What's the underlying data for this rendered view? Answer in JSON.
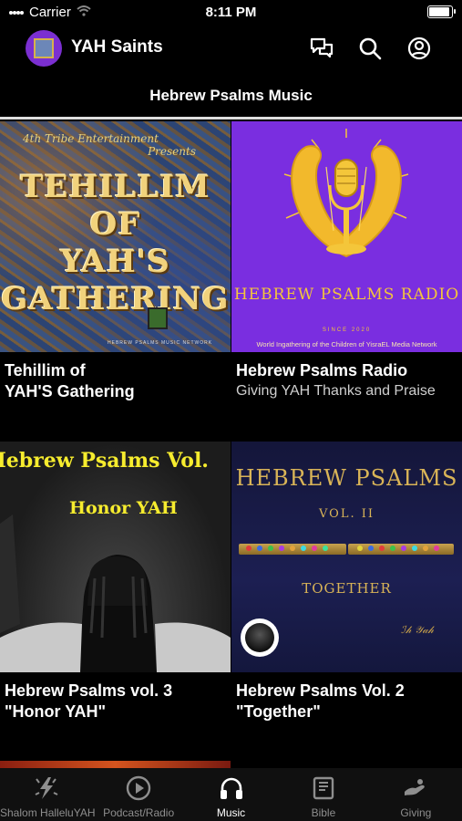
{
  "status_bar": {
    "carrier": "Carrier",
    "time": "8:11 PM"
  },
  "app_bar": {
    "title": "YAH Saints",
    "icons": [
      "chat-icon",
      "search-icon",
      "account-icon"
    ]
  },
  "screen": {
    "title": "Hebrew Psalms Music"
  },
  "albums": [
    {
      "title": "Tehillim of\nYAH'S Gathering",
      "subtitle": "",
      "art": {
        "presents_line1": "4th Tribe Entertainment",
        "presents_line2": "Presents",
        "headline": "TEHILLIM\nOF\nYAH'S\nGATHERING",
        "footer": "HEBREW PSALMS MUSIC NETWORK"
      }
    },
    {
      "title": "Hebrew Psalms Radio",
      "subtitle": "Giving YAH Thanks and Praise",
      "art": {
        "headline": "HEBREW PSALMS RADIO",
        "since": "SINCE 2020",
        "network": "World Ingathering of the Children of YisraEL Media Network"
      }
    },
    {
      "title": "Hebrew Psalms vol. 3\n\"Honor YAH\"",
      "subtitle": "",
      "art": {
        "headline": "Hebrew Psalms Vol.",
        "subheadline": "Honor YAH"
      }
    },
    {
      "title": "Hebrew Psalms Vol. 2\n\"Together\"",
      "subtitle": "",
      "art": {
        "headline": "HEBREW PSALMS",
        "volume": "VOL. II",
        "tagline": "TOGETHER"
      }
    }
  ],
  "tab_bar": {
    "active": "Music",
    "tabs": [
      {
        "label": "Shalom HalleluYAH",
        "icon": "sparkle-icon"
      },
      {
        "label": "Podcast/Radio",
        "icon": "play-circle-icon"
      },
      {
        "label": "Music",
        "icon": "headphones-icon"
      },
      {
        "label": "Bible",
        "icon": "book-icon"
      },
      {
        "label": "Giving",
        "icon": "giving-hand-icon"
      }
    ]
  },
  "colors": {
    "background": "#000000",
    "radio_purple": "#7a2ee0",
    "gold": "#f4c63a",
    "inactive_tab": "#8e8e8e"
  }
}
